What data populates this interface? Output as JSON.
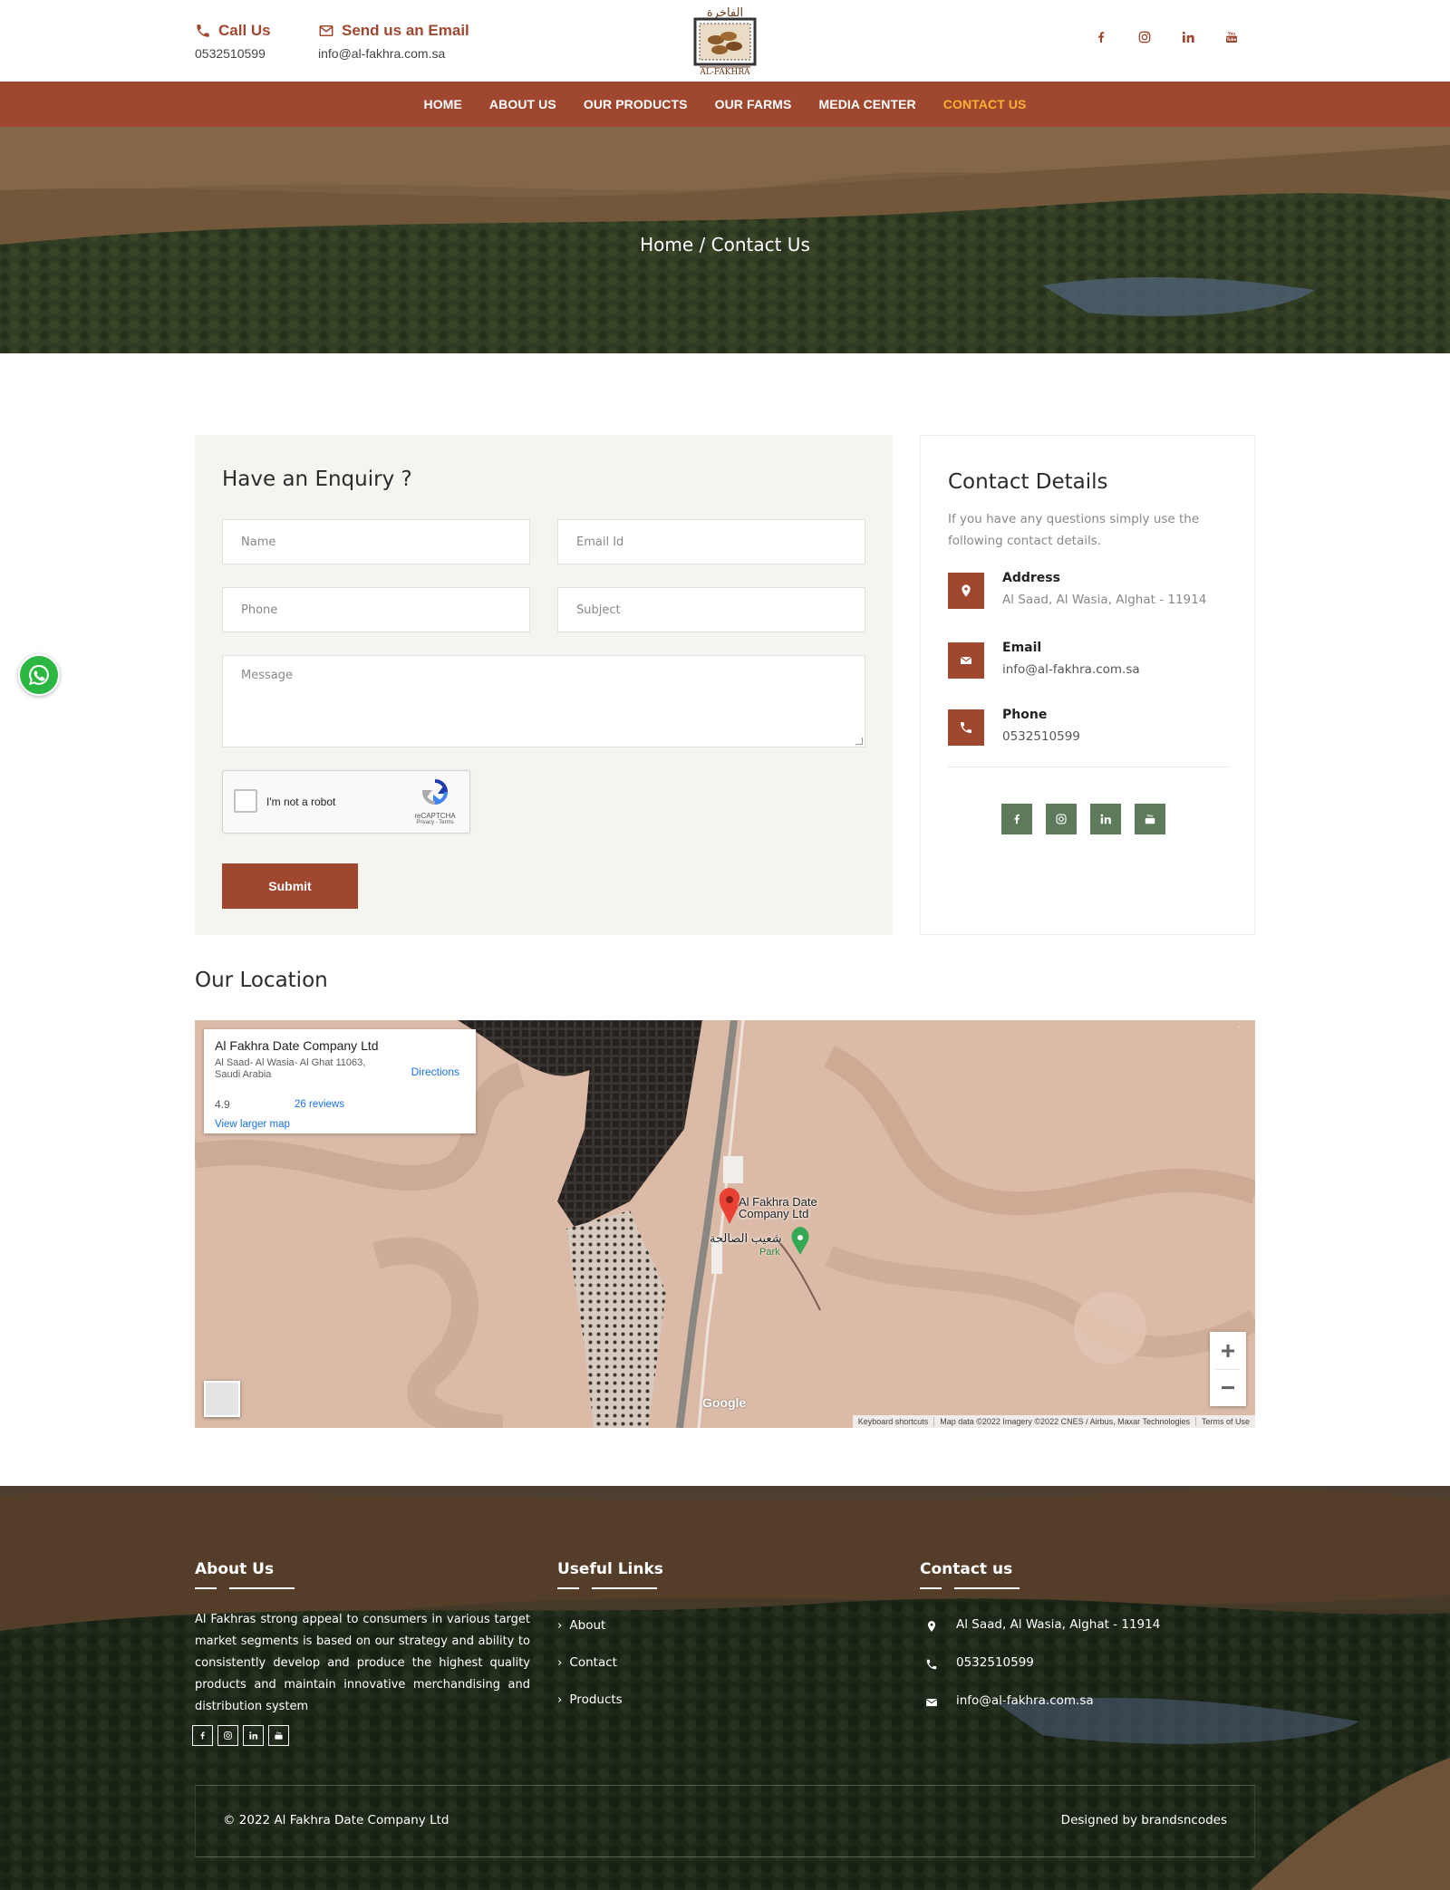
{
  "header": {
    "call_title": "Call Us",
    "call_value": "0532510599",
    "email_title": "Send us an Email",
    "email_value": "info@al-fakhra.com.sa",
    "logo_text_ar": "الفاخرة",
    "logo_text_en": "AL-FAKHRA",
    "social": [
      "facebook-icon",
      "instagram-icon",
      "linkedin-icon",
      "youtube-icon"
    ]
  },
  "nav": {
    "items": [
      {
        "label": "HOME",
        "active": false
      },
      {
        "label": "ABOUT US",
        "active": false
      },
      {
        "label": "OUR PRODUCTS",
        "active": false
      },
      {
        "label": "OUR FARMS",
        "active": false
      },
      {
        "label": "MEDIA CENTER",
        "active": false
      },
      {
        "label": "CONTACT US",
        "active": true
      }
    ]
  },
  "hero": {
    "breadcrumb": "Home / Contact Us"
  },
  "enquiry": {
    "title": "Have an Enquiry ?",
    "name_placeholder": "Name",
    "email_placeholder": "Email Id",
    "phone_placeholder": "Phone",
    "subject_placeholder": "Subject",
    "message_placeholder": "Message",
    "captcha_label": "I'm not a robot",
    "captcha_brand": "reCAPTCHA",
    "captcha_links": "Privacy - Terms",
    "submit_label": "Submit"
  },
  "details": {
    "title": "Contact Details",
    "intro": "If you have any questions simply use the following contact details.",
    "address_title": "Address",
    "address_value": "Al Saad, Al Wasia, Alghat - 11914",
    "email_title": "Email",
    "email_value": "info@al-fakhra.com.sa",
    "phone_title": "Phone",
    "phone_value": "0532510599"
  },
  "location": {
    "title": "Our Location",
    "card_title": "Al Fakhra Date Company Ltd",
    "card_address": "Al Saad- Al Wasia- Al Ghat 11063, Saudi Arabia",
    "directions": "Directions",
    "rating": "4.9",
    "reviews": "26 reviews",
    "view_larger": "View larger map",
    "pin_label_line1": "Al Fakhra Date",
    "pin_label_line2": "Company Ltd",
    "park_label": "Park",
    "arabic_label": "شعيب الصالحة",
    "google": "Google",
    "footer_links": [
      "Keyboard shortcuts",
      "Map data ©2022 Imagery ©2022 CNES / Airbus, Maxar Technologies",
      "Terms of Use"
    ]
  },
  "footer": {
    "about_title": "About Us",
    "about_text": "Al Fakhras strong appeal to consumers in various target market segments is based on our strategy and ability to consistently develop and produce the highest quality products and maintain innovative merchandising and distribution system",
    "links_title": "Useful Links",
    "links": [
      "About",
      "Contact",
      "Products"
    ],
    "contact_title": "Contact us",
    "address": "Al Saad, Al Wasia, Alghat - 11914",
    "phone": "0532510599",
    "email": "info@al-fakhra.com.sa",
    "copyright": "© 2022 Al Fakhra Date Company Ltd",
    "designed_by": "Designed by brandsncodes"
  },
  "colors": {
    "brand": "#a0472f",
    "nav_active": "#f9b233",
    "social_green": "#5d7a5a",
    "whatsapp": "#2bb741"
  }
}
